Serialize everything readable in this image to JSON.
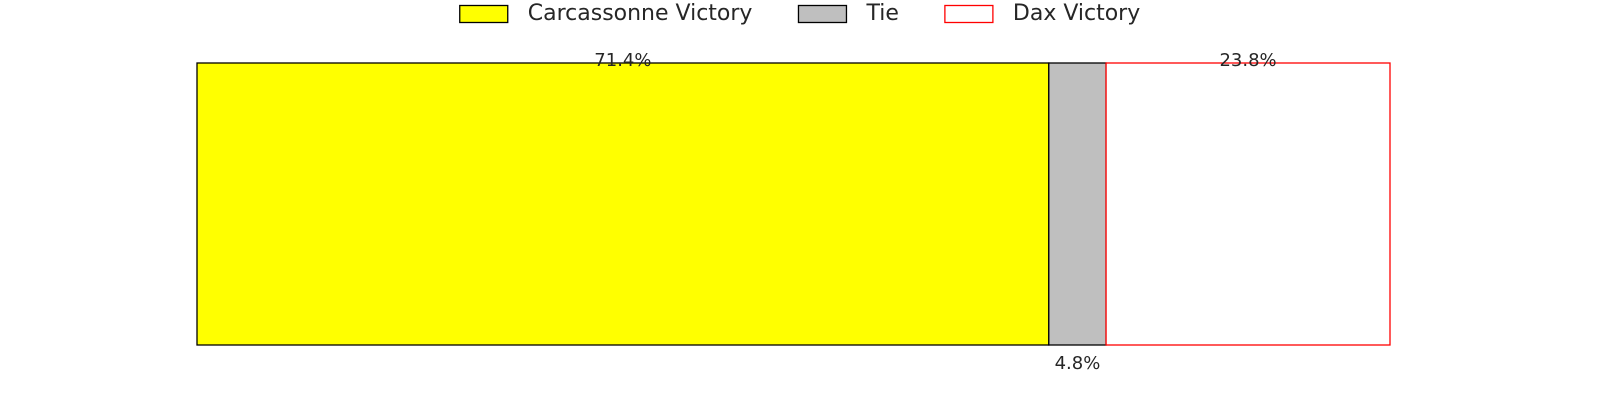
{
  "chart_data": {
    "type": "bar",
    "orientation": "horizontal-stacked",
    "unit": "%",
    "categories": [
      ""
    ],
    "series": [
      {
        "name": "Carcassonne Victory",
        "values": [
          71.4
        ],
        "label": "71.4%",
        "fill": "#ffff00",
        "stroke": "#000000",
        "label_position": "above"
      },
      {
        "name": "Tie",
        "values": [
          4.8
        ],
        "label": "4.8%",
        "fill": "#bfbfbf",
        "stroke": "#000000",
        "label_position": "below"
      },
      {
        "name": "Dax Victory",
        "values": [
          23.8
        ],
        "label": "23.8%",
        "fill": "#ffffff",
        "stroke": "#ff0000",
        "label_position": "above"
      }
    ],
    "xlim": [
      0,
      100
    ],
    "axes_visible": false,
    "grid": false,
    "legend_position": "top-center"
  }
}
